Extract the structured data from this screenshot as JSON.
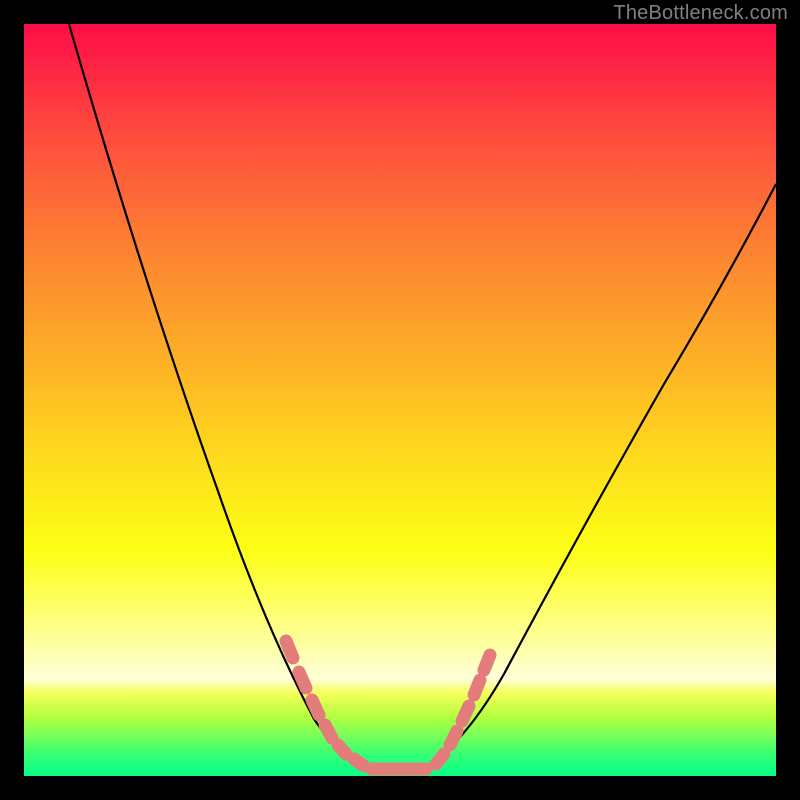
{
  "watermark": {
    "text": "TheBottleneck.com"
  },
  "colors": {
    "curve": "#000000",
    "marker": "#e47c7c",
    "frame": "#000000"
  },
  "chart_data": {
    "type": "line",
    "title": "",
    "xlabel": "",
    "ylabel": "",
    "xlim": [
      0,
      100
    ],
    "ylim": [
      0,
      100
    ],
    "grid": false,
    "legend": false,
    "series": [
      {
        "name": "bottleneck-curve-left",
        "x": [
          6,
          10,
          14,
          18,
          22,
          26,
          30,
          34,
          36,
          38,
          40,
          42,
          44,
          46,
          48
        ],
        "values": [
          100,
          87,
          74,
          62,
          51,
          41,
          32,
          23,
          19,
          15,
          11,
          8,
          5,
          3,
          1
        ]
      },
      {
        "name": "bottleneck-curve-right",
        "x": [
          48,
          52,
          56,
          60,
          64,
          68,
          72,
          76,
          80,
          84,
          88,
          92,
          96,
          100
        ],
        "values": [
          1,
          3,
          8,
          14,
          21,
          28,
          35,
          42,
          49,
          55,
          62,
          68,
          74,
          79
        ]
      }
    ],
    "markers": {
      "name": "highlight-segment",
      "x": [
        36,
        38,
        40,
        42,
        44,
        46,
        48,
        50,
        52,
        54,
        56,
        58
      ],
      "values": [
        19,
        15,
        11,
        8,
        5,
        3,
        1,
        1,
        3,
        6,
        10,
        14
      ]
    }
  }
}
